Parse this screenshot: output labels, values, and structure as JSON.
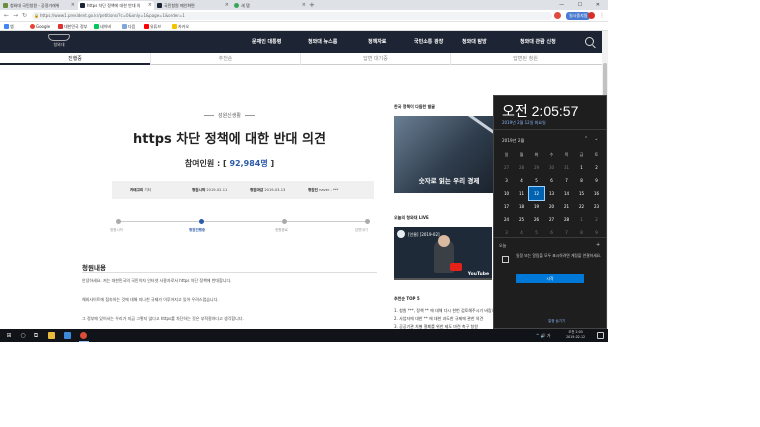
{
  "browser": {
    "tabs": [
      {
        "title": "청와대 국민청원 - 공정거래위",
        "fav": "#6b8f3f",
        "active": false
      },
      {
        "title": "https 차단 정책에 대한 반대 의",
        "fav": "#1d2433",
        "active": true
      },
      {
        "title": "국민청원 메인화면",
        "fav": "#1d2433",
        "active": false
      },
      {
        "title": "새 탭",
        "fav": "#3aa757",
        "active": false
      }
    ],
    "new_tab": "+",
    "url": "https://www1.president.go.kr/petitions/?c=0&only=1&page=1&order=1",
    "profile_label": "일시중지됨",
    "bookmarks": [
      {
        "label": "앱",
        "color": "#4285f4"
      },
      {
        "label": "Google",
        "color": "#ea4335"
      },
      {
        "label": "대한민국 정부",
        "color": "#d33"
      },
      {
        "label": "네이버",
        "color": "#03c75a"
      },
      {
        "label": "다음",
        "color": "#7fa7d9"
      },
      {
        "label": "유튜브",
        "color": "#ff0000"
      },
      {
        "label": "카카오",
        "color": "#f5c400"
      }
    ]
  },
  "site": {
    "logo_text": "청와대",
    "gnb": [
      "문재인 대통령",
      "청와대 뉴스룸",
      "정책자료",
      "국민소통 광장",
      "청와대 탐방",
      "청와대 관람 신청"
    ],
    "subtabs": [
      "진행중",
      "추천순",
      "답변 대기중",
      "답변된 청원"
    ]
  },
  "petition": {
    "category": "성원신생활",
    "title": "https 차단 정책에 대한 반대 의견",
    "count_label": "참여인원 : [",
    "count": "92,984명",
    "count_close": "]",
    "info": [
      {
        "k": "카테고리",
        "v": "기타"
      },
      {
        "k": "청원시작",
        "v": "2019-02-11"
      },
      {
        "k": "청원마감",
        "v": "2019-03-13"
      },
      {
        "k": "청원인",
        "v": "naver - ***"
      }
    ],
    "steps": [
      "청원시작",
      "청원진행중",
      "청원종료",
      "답변대기"
    ],
    "active_step": 1,
    "section_title": "청원내용",
    "body": [
      "안녕하세요. 저는 대한민국의 국민이자 인터넷 사용자로서 https 차단 정책에 반대합니다.",
      "해외사이트에 접속하는 것에 대해 지나친 규제가 이루어지고 있어 우려스럽습니다.",
      "그 정부에 있어서는 우리가 지금 그렇지 않다고 https를 차단하는 것은 부적절하다고 생각합니다."
    ]
  },
  "sidebar": {
    "heading1": "한국 정책이 다듬한 발굴",
    "img1_caption": "숫자로 읽는 우리 경제",
    "heading2": "오늘의 청와대 LIVE",
    "video_title": "[인물] [2019-02] ...",
    "video_brand": "YouTube",
    "heading3": "추천순 TOP 5",
    "list": [
      "1. 청원 ***, 정책 ** 에 대해 다시 한번 검토해주시기 바랍니다",
      "2. 사업자에 대한 ** 에 대한 과도한 규제에 관한 의견",
      "3. 공공기관 차별 철폐를 위한 제도 마련 촉구 청원"
    ]
  },
  "clock_flyout": {
    "time": "오전 2:05:57",
    "date": "2019년 2월 12일 화요일",
    "month": "2019년 2월",
    "weekdays": [
      "일",
      "월",
      "화",
      "수",
      "목",
      "금",
      "토"
    ],
    "days": [
      [
        "27",
        "28",
        "29",
        "30",
        "31",
        "1",
        "2"
      ],
      [
        "3",
        "4",
        "5",
        "6",
        "7",
        "8",
        "9"
      ],
      [
        "10",
        "11",
        "12",
        "13",
        "14",
        "15",
        "16"
      ],
      [
        "17",
        "18",
        "19",
        "20",
        "21",
        "22",
        "23"
      ],
      [
        "24",
        "25",
        "26",
        "27",
        "28",
        "1",
        "2"
      ],
      [
        "3",
        "4",
        "5",
        "6",
        "7",
        "8",
        "9"
      ]
    ],
    "today": "12",
    "today_label": "오늘",
    "event_text": "일정 또는 알림을 모두 표시하려면 계정을 연결하세요.",
    "button": "시작",
    "hide_link": "일정 숨기기"
  },
  "taskbar": {
    "start": "⊞",
    "tray_text": "^ 🔊 가",
    "time": "오전 2:05",
    "date": "2019-02-12"
  }
}
